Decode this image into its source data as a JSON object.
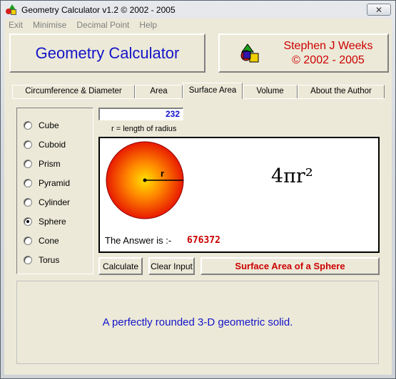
{
  "window": {
    "title": "Geometry Calculator v1.2 ©  2002 - 2005",
    "close_label": "✕"
  },
  "menu": [
    "Exit",
    "Minimise",
    "Decimal Point",
    "Help"
  ],
  "header": {
    "app_name": "Geometry Calculator",
    "author_line1": "Stephen J Weeks",
    "author_line2": "© 2002 - 2005"
  },
  "tabs": [
    {
      "label": "Circumference & Diameter",
      "active": false
    },
    {
      "label": "Area",
      "active": false
    },
    {
      "label": "Surface Area",
      "active": true
    },
    {
      "label": "Volume",
      "active": false
    },
    {
      "label": "About the Author",
      "active": false
    }
  ],
  "shapes": [
    {
      "label": "Cube",
      "checked": false
    },
    {
      "label": "Cuboid",
      "checked": false
    },
    {
      "label": "Prism",
      "checked": false
    },
    {
      "label": "Pyramid",
      "checked": false
    },
    {
      "label": "Cylinder",
      "checked": false
    },
    {
      "label": "Sphere",
      "checked": true
    },
    {
      "label": "Cone",
      "checked": false
    },
    {
      "label": "Torus",
      "checked": false
    }
  ],
  "input": {
    "radius_value": "232",
    "radius_caption": "r = length of radius"
  },
  "display": {
    "radius_label": "r",
    "formula": "4πr²",
    "answer_label": "The Answer is :-",
    "answer_value": "676372"
  },
  "buttons": {
    "calculate": "Calculate",
    "clear_input": "Clear Input",
    "shape_title": "Surface Area of a Sphere"
  },
  "description": "A perfectly rounded 3-D geometric solid.",
  "colors": {
    "title_blue": "#1414c8",
    "author_red": "#cc0000",
    "dialog_face": "#ece9d8"
  }
}
